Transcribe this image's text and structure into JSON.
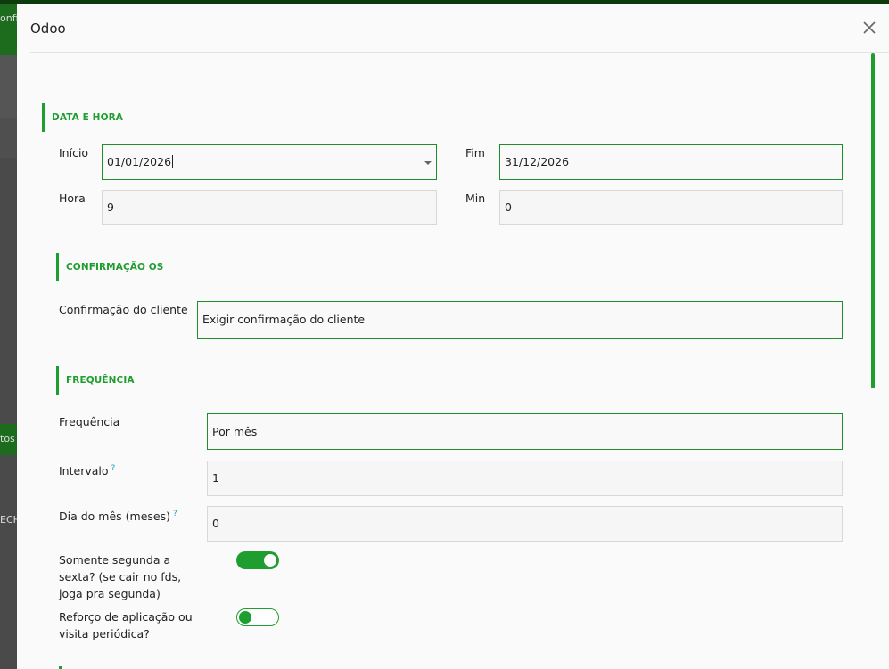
{
  "background": {
    "text_top": "onfig",
    "text_mid": "tos",
    "text_low": "ECH"
  },
  "modal": {
    "title": "Odoo",
    "close_icon": "close-icon"
  },
  "sections": {
    "date_time": {
      "title": "DATA E HORA",
      "start_label": "Início",
      "start_value": "01/01/2026",
      "end_label": "Fim",
      "end_value": "31/12/2026",
      "hour_label": "Hora",
      "hour_value": "9",
      "min_label": "Min",
      "min_value": "0"
    },
    "confirmation": {
      "title": "CONFIRMAÇÃO OS",
      "client_label": "Confirmação do cliente",
      "client_value": "Exigir confirmação do cliente"
    },
    "frequency": {
      "title": "FREQUÊNCIA",
      "frequency_label": "Frequência",
      "frequency_value": "Por mês",
      "interval_label": "Intervalo",
      "interval_value": "1",
      "day_label": "Dia do mês (meses)",
      "day_value": "0",
      "help_mark": "?",
      "weekdays_label_1": "Somente segunda a",
      "weekdays_label_2": "sexta? (se cair no fds,",
      "weekdays_label_3": "joga pra segunda)",
      "weekdays_on": true,
      "reinforce_label_1": "Reforço de aplicação ou",
      "reinforce_label_2": "visita periódica?",
      "reinforce_on": false
    }
  },
  "colors": {
    "accent": "#1e9e2e",
    "help": "#1e9ec8"
  }
}
